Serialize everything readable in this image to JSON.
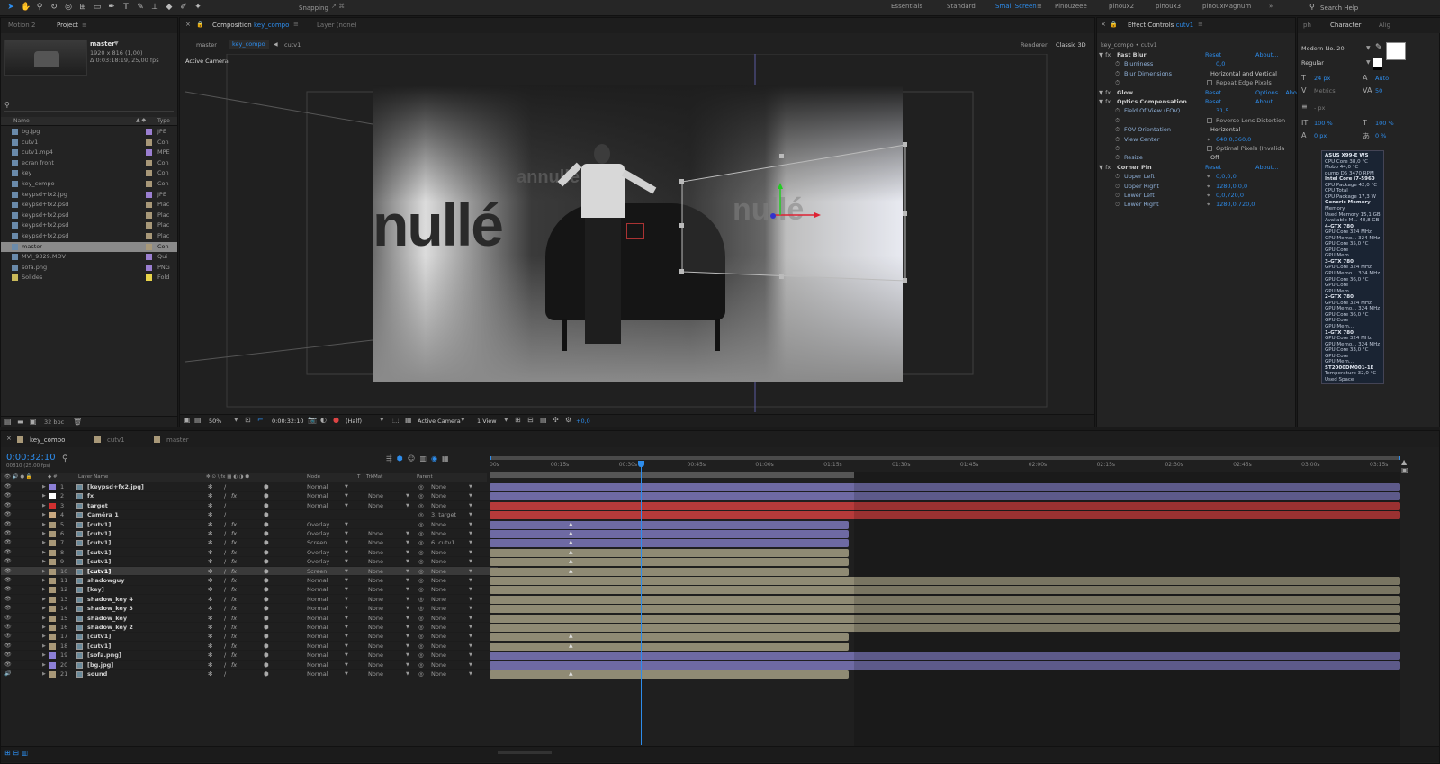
{
  "toolbar": {
    "snapping": "Snapping",
    "workspaces": [
      "Essentials",
      "Standard",
      "Small Screen",
      "Pinouzeee",
      "pinoux2",
      "pinoux3",
      "pinouxMagnum"
    ],
    "active_workspace": "Small Screen",
    "search_help": "Search Help"
  },
  "project": {
    "tabs": [
      "Motion 2",
      "Project"
    ],
    "item_name": "master",
    "item_info1": "1920 x 816 (1,00)",
    "item_info2": "Δ 0:03:18:19, 25,00 fps",
    "col_name": "Name",
    "col_type": "Type",
    "items": [
      {
        "name": "bg.jpg",
        "type": "JPE",
        "color": "#9b7fd1"
      },
      {
        "name": "cutv1",
        "type": "Con",
        "color": "#a89878"
      },
      {
        "name": "cutv1.mp4",
        "type": "MPE",
        "color": "#9b7fd1"
      },
      {
        "name": "ecran front",
        "type": "Con",
        "color": "#a89878"
      },
      {
        "name": "key",
        "type": "Con",
        "color": "#a89878"
      },
      {
        "name": "key_compo",
        "type": "Con",
        "color": "#a89878"
      },
      {
        "name": "keypsd+fx2.jpg",
        "type": "JPE",
        "color": "#9b7fd1"
      },
      {
        "name": "keypsd+fx2.psd",
        "type": "Plac",
        "color": "#a89878"
      },
      {
        "name": "keypsd+fx2.psd",
        "type": "Plac",
        "color": "#a89878"
      },
      {
        "name": "keypsd+fx2.psd",
        "type": "Plac",
        "color": "#a89878"
      },
      {
        "name": "keypsd+fx2.psd",
        "type": "Plac",
        "color": "#a89878"
      },
      {
        "name": "master",
        "type": "Con",
        "color": "#a89878"
      },
      {
        "name": "MVI_9329.MOV",
        "type": "Qui",
        "color": "#9b7fd1"
      },
      {
        "name": "sofa.png",
        "type": "PNG",
        "color": "#9b7fd1"
      },
      {
        "name": "Solides",
        "type": "Fold",
        "color": "#e8d44a"
      }
    ],
    "selected_index": 11,
    "bpc": "32 bpc"
  },
  "composition": {
    "tab_label": "Composition",
    "comp_name": "key_compo",
    "layer_tab": "Layer (none)",
    "nav": [
      "master",
      "key_compo",
      "cutv1"
    ],
    "renderer_label": "Renderer:",
    "renderer": "Classic 3D",
    "active_camera": "Active Camera",
    "frame_text": "nullé",
    "frame_text_ghost": "annullé",
    "zoom": "50%",
    "timecode": "0:00:32:10",
    "resolution": "(Half)",
    "camera": "Active Camera",
    "view": "1 View",
    "exposure": "+0,0"
  },
  "effect_controls": {
    "title": "Effect Controls",
    "layer": "cutv1",
    "breadcrumb": "key_compo • cutv1",
    "rows": [
      {
        "label": "Fast Blur",
        "value": "Reset",
        "extra": "About...",
        "kind": "effect"
      },
      {
        "label": "Blurriness",
        "value": "0,0",
        "kind": "param"
      },
      {
        "label": "Blur Dimensions",
        "value": "Horizontal and Vertical",
        "kind": "param"
      },
      {
        "label": "",
        "value": "Repeat Edge Pixels",
        "kind": "check"
      },
      {
        "label": "Glow",
        "value": "Reset",
        "extra": "Options... About...",
        "kind": "effect"
      },
      {
        "label": "Optics Compensation",
        "value": "Reset",
        "extra": "About...",
        "kind": "effect"
      },
      {
        "label": "Field Of View (FOV)",
        "value": "31,5",
        "kind": "param"
      },
      {
        "label": "",
        "value": "Reverse Lens Distortion",
        "kind": "check"
      },
      {
        "label": "FOV Orientation",
        "value": "Horizontal",
        "kind": "param"
      },
      {
        "label": "View Center",
        "value": "640,0,360,0",
        "kind": "param"
      },
      {
        "label": "",
        "value": "Optimal Pixels (Invalida",
        "kind": "check"
      },
      {
        "label": "Resize",
        "value": "Off",
        "kind": "param"
      },
      {
        "label": "Corner Pin",
        "value": "Reset",
        "extra": "About...",
        "kind": "effect"
      },
      {
        "label": "Upper Left",
        "value": "0,0,0,0",
        "kind": "param"
      },
      {
        "label": "Upper Right",
        "value": "1280,0,0,0",
        "kind": "param"
      },
      {
        "label": "Lower Left",
        "value": "0,0,720,0",
        "kind": "param"
      },
      {
        "label": "Lower Right",
        "value": "1280,0,720,0",
        "kind": "param"
      }
    ]
  },
  "character": {
    "tabs": [
      "ph",
      "Character",
      "Alig"
    ],
    "font": "Modern No. 20",
    "style": "Regular",
    "size": "24 px",
    "leading": "Auto",
    "kerning": "Metrics",
    "tracking": "50",
    "stroke": "- px",
    "vscale": "100 %",
    "hscale": "100 %",
    "baseline": "0 px",
    "tsume": "0 %"
  },
  "hud": {
    "lines": [
      {
        "t": "ASUS X99-E WS",
        "h": true
      },
      {
        "t": "CPU Core        38,0 °C"
      },
      {
        "t": "Mobo            44,0 °C"
      },
      {
        "t": "pump D5       3470 RPM"
      },
      {
        "t": "Intel Core i7-5960",
        "h": true
      },
      {
        "t": "CPU Package    42,0 °C"
      },
      {
        "t": "CPU Total"
      },
      {
        "t": "CPU Package    17,3 W"
      },
      {
        "t": "Generic Memory",
        "h": true
      },
      {
        "t": "Memory"
      },
      {
        "t": "Used Memory   15,1 GB"
      },
      {
        "t": "Available M...  48,8 GB"
      },
      {
        "t": "4-GTX 780",
        "h": true
      },
      {
        "t": "GPU Core      324 MHz"
      },
      {
        "t": "GPU Memo...   324 MHz"
      },
      {
        "t": "GPU Core       35,0 °C"
      },
      {
        "t": "GPU Core"
      },
      {
        "t": "GPU Mem..."
      },
      {
        "t": "3-GTX 780",
        "h": true
      },
      {
        "t": "GPU Core      324 MHz"
      },
      {
        "t": "GPU Memo...   324 MHz"
      },
      {
        "t": "GPU Core       36,0 °C"
      },
      {
        "t": "GPU Core"
      },
      {
        "t": "GPU Mem..."
      },
      {
        "t": "2-GTX 780",
        "h": true
      },
      {
        "t": "GPU Core      324 MHz"
      },
      {
        "t": "GPU Memo...   324 MHz"
      },
      {
        "t": "GPU Core       36,0 °C"
      },
      {
        "t": "GPU Core"
      },
      {
        "t": "GPU Mem..."
      },
      {
        "t": "1-GTX 780",
        "h": true
      },
      {
        "t": "GPU Core      324 MHz"
      },
      {
        "t": "GPU Memo...   324 MHz"
      },
      {
        "t": "GPU Core       33,0 °C"
      },
      {
        "t": "GPU Core"
      },
      {
        "t": "GPU Mem..."
      },
      {
        "t": "ST2000DM001-1E",
        "h": true
      },
      {
        "t": "Temperature    32,0 °C"
      },
      {
        "t": "Used Space"
      }
    ]
  },
  "timeline": {
    "tabs": [
      "key_compo",
      "cutv1",
      "master"
    ],
    "timecode": "0:00:32:10",
    "frame_info": "00810 (25.00 fps)",
    "col_layer": "Layer Name",
    "col_mode": "Mode",
    "col_t": "T",
    "col_trkmat": "TrkMat",
    "col_parent": "Parent",
    "ruler": [
      "00s",
      "00:15s",
      "00:30s",
      "00:45s",
      "01:00s",
      "01:15s",
      "01:30s",
      "01:45s",
      "02:00s",
      "02:15s",
      "02:30s",
      "02:45s",
      "03:00s",
      "03:15s"
    ],
    "current_time_fraction": 0.111,
    "work_area_end_fraction": 0.2,
    "layers": [
      {
        "n": "1",
        "name": "[keypsd+fx2.jpg]",
        "color": "#8c7fd6",
        "mode": "Normal",
        "trk": "",
        "parent": "None",
        "bar": "purple",
        "end": 1.0,
        "fx": false
      },
      {
        "n": "2",
        "name": "fx",
        "color": "#ffffff",
        "mode": "Normal",
        "trk": "None",
        "parent": "None",
        "bar": "purple",
        "end": 1.0,
        "fx": true
      },
      {
        "n": "3",
        "name": "target",
        "color": "#d03030",
        "mode": "Normal",
        "trk": "None",
        "parent": "None",
        "bar": "red",
        "end": 1.0,
        "fx": false
      },
      {
        "n": "4",
        "name": "Caméra 1",
        "color": "#c8a880",
        "mode": "",
        "trk": "",
        "parent": "3. target",
        "bar": "red",
        "end": 1.0,
        "fx": false
      },
      {
        "n": "5",
        "name": "[cutv1]",
        "color": "#a89878",
        "mode": "Overlay",
        "trk": "",
        "parent": "None",
        "bar": "purple",
        "end": 0.263,
        "fx": true
      },
      {
        "n": "6",
        "name": "[cutv1]",
        "color": "#a89878",
        "mode": "Overlay",
        "trk": "None",
        "parent": "None",
        "bar": "purple",
        "end": 0.263,
        "fx": true
      },
      {
        "n": "7",
        "name": "[cutv1]",
        "color": "#a89878",
        "mode": "Screen",
        "trk": "None",
        "parent": "6. cutv1",
        "bar": "purple",
        "end": 0.263,
        "fx": true
      },
      {
        "n": "8",
        "name": "[cutv1]",
        "color": "#a89878",
        "mode": "Overlay",
        "trk": "None",
        "parent": "None",
        "bar": "tan",
        "end": 0.263,
        "fx": true
      },
      {
        "n": "9",
        "name": "[cutv1]",
        "color": "#a89878",
        "mode": "Overlay",
        "trk": "None",
        "parent": "None",
        "bar": "tan",
        "end": 0.263,
        "fx": true
      },
      {
        "n": "10",
        "name": "[cutv1]",
        "color": "#a89878",
        "mode": "Screen",
        "trk": "None",
        "parent": "None",
        "bar": "tan",
        "end": 0.263,
        "fx": true,
        "selected": true
      },
      {
        "n": "11",
        "name": "shadowguy",
        "color": "#a89878",
        "mode": "Normal",
        "trk": "None",
        "parent": "None",
        "bar": "tan",
        "end": 1.0,
        "fx": true
      },
      {
        "n": "12",
        "name": "[key]",
        "color": "#a89878",
        "mode": "Normal",
        "trk": "None",
        "parent": "None",
        "bar": "tan",
        "end": 1.0,
        "fx": true
      },
      {
        "n": "13",
        "name": "shadow_key 4",
        "color": "#a89878",
        "mode": "Normal",
        "trk": "None",
        "parent": "None",
        "bar": "tan",
        "end": 1.0,
        "fx": true
      },
      {
        "n": "14",
        "name": "shadow_key 3",
        "color": "#a89878",
        "mode": "Normal",
        "trk": "None",
        "parent": "None",
        "bar": "tan",
        "end": 1.0,
        "fx": true
      },
      {
        "n": "15",
        "name": "shadow_key",
        "color": "#a89878",
        "mode": "Normal",
        "trk": "None",
        "parent": "None",
        "bar": "tan",
        "end": 1.0,
        "fx": true
      },
      {
        "n": "16",
        "name": "shadow_key 2",
        "color": "#a89878",
        "mode": "Normal",
        "trk": "None",
        "parent": "None",
        "bar": "tan",
        "end": 1.0,
        "fx": true
      },
      {
        "n": "17",
        "name": "[cutv1]",
        "color": "#a89878",
        "mode": "Normal",
        "trk": "None",
        "parent": "None",
        "bar": "tan",
        "end": 0.263,
        "fx": true
      },
      {
        "n": "18",
        "name": "[cutv1]",
        "color": "#a89878",
        "mode": "Normal",
        "trk": "None",
        "parent": "None",
        "bar": "tan",
        "end": 0.263,
        "fx": true
      },
      {
        "n": "19",
        "name": "[sofa.png]",
        "color": "#8c7fd6",
        "mode": "Normal",
        "trk": "None",
        "parent": "None",
        "bar": "purple",
        "end": 1.0,
        "fx": true
      },
      {
        "n": "20",
        "name": "[bg.jpg]",
        "color": "#8c7fd6",
        "mode": "Normal",
        "trk": "None",
        "parent": "None",
        "bar": "purple",
        "end": 1.0,
        "fx": true
      },
      {
        "n": "21",
        "name": "sound",
        "color": "#a89878",
        "mode": "Normal",
        "trk": "None",
        "parent": "None",
        "bar": "tan",
        "end": 0.263,
        "fx": false
      }
    ]
  },
  "colors": {
    "accent": "#2d8ceb",
    "purple_bar": "#6e6aa3",
    "tan_bar": "#8f8a74",
    "red_bar": "#b63a3a"
  }
}
